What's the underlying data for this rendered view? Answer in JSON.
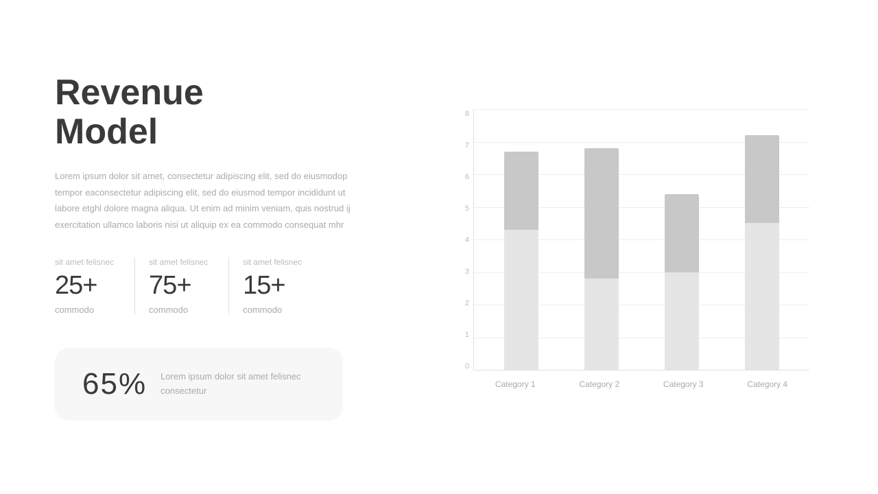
{
  "title": {
    "line1": "Revenue",
    "line2": "Model"
  },
  "description": "Lorem ipsum dolor sit amet, consectetur adipiscing elit, sed do eiusmodop tempor eaconsectetur adipiscing elit, sed do eiusmod tempor incididunt ut labore etghl dolore magna aliqua. Ut enim ad minim veniam, quis nostrud ij exercitation ullamco laboris nisi ut aliquip ex ea commodo consequat mhr",
  "stats": [
    {
      "label": "sit amet felisnec",
      "value": "25+",
      "sub": "commodo"
    },
    {
      "label": "sit amet felisnec",
      "value": "75+",
      "sub": "commodo"
    },
    {
      "label": "sit amet felisnec",
      "value": "15+",
      "sub": "commodo"
    }
  ],
  "card": {
    "percent": "65%",
    "text_line1": "Lorem ipsum dolor sit amet felisnec",
    "text_line2": "consectetur"
  },
  "chart": {
    "y_labels": [
      "0",
      "1",
      "2",
      "3",
      "4",
      "5",
      "6",
      "7",
      "8"
    ],
    "categories": [
      "Category 1",
      "Category 2",
      "Category 3",
      "Category 4"
    ],
    "bars": [
      {
        "bottom": 4.3,
        "top": 2.4
      },
      {
        "bottom": 2.8,
        "top": 4.0
      },
      {
        "bottom": 3.0,
        "top": 2.4
      },
      {
        "bottom": 4.5,
        "top": 2.7
      }
    ],
    "max_value": 8,
    "colors": {
      "top": "#c8c8c8",
      "bottom": "#e5e5e5"
    }
  }
}
